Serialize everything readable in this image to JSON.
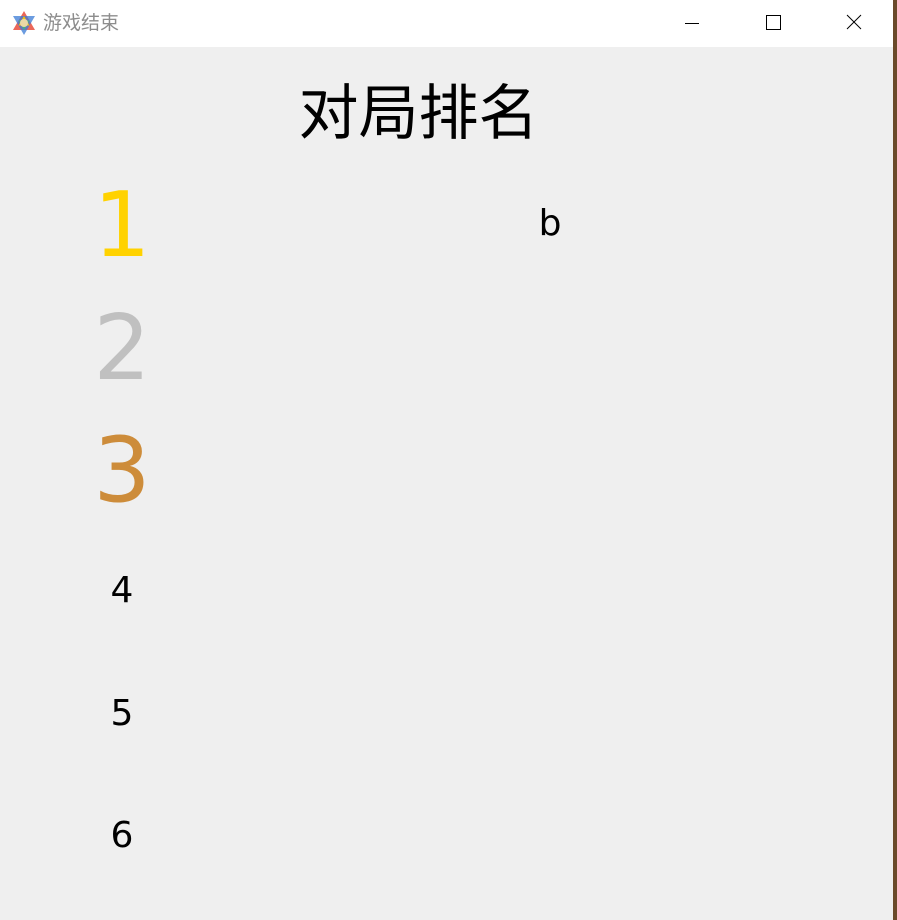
{
  "window": {
    "title": "游戏结束",
    "icon": "star-of-david-icon",
    "controls": [
      "minimize-icon",
      "maximize-icon",
      "close-icon"
    ]
  },
  "ranking": {
    "title": "对局排名",
    "rows": [
      {
        "rank": "1",
        "player": "b",
        "color": "#ffd200"
      },
      {
        "rank": "2",
        "player": "",
        "color": "#c0c0c0"
      },
      {
        "rank": "3",
        "player": "",
        "color": "#cd8c3a"
      },
      {
        "rank": "4",
        "player": "",
        "color": "#000000"
      },
      {
        "rank": "5",
        "player": "",
        "color": "#000000"
      },
      {
        "rank": "6",
        "player": "",
        "color": "#000000"
      }
    ]
  }
}
